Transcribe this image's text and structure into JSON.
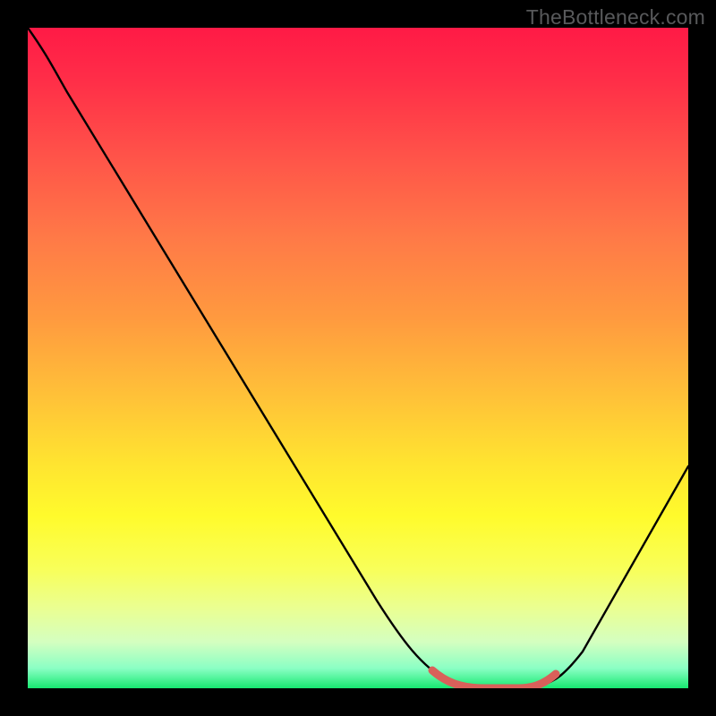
{
  "watermark": "TheBottleneck.com",
  "chart_data": {
    "type": "line",
    "title": "",
    "xlabel": "",
    "ylabel": "",
    "xlim": [
      0,
      100
    ],
    "ylim": [
      0,
      100
    ],
    "gridlines": false,
    "series": [
      {
        "name": "main-curve",
        "color": "#000000",
        "x": [
          0,
          4,
          10,
          20,
          30,
          40,
          50,
          58,
          62,
          66,
          70,
          74,
          77,
          80,
          86,
          92,
          100
        ],
        "y": [
          100,
          94,
          86,
          72,
          58,
          44,
          30,
          18,
          10,
          4,
          1,
          0,
          0,
          1,
          8,
          18,
          34
        ]
      },
      {
        "name": "highlight-segment",
        "color": "#e06666",
        "x": [
          62,
          66,
          70,
          74,
          77,
          80
        ],
        "y": [
          10,
          4,
          1,
          0,
          0,
          1
        ]
      }
    ],
    "background_gradient": {
      "top": "#ff1a46",
      "mid": "#ffe430",
      "bottom": "#17e870"
    }
  }
}
